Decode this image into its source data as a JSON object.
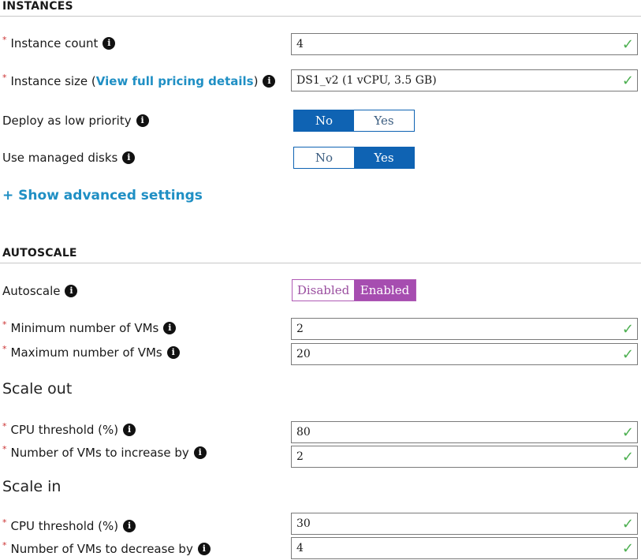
{
  "instances": {
    "heading": "INSTANCES",
    "instance_count": {
      "label": "Instance count",
      "value": "4"
    },
    "instance_size": {
      "label_prefix": "Instance size (",
      "link": "View full pricing details",
      "label_suffix": ")",
      "value": "DS1_v2 (1 vCPU, 3.5 GB)"
    },
    "low_priority": {
      "label": "Deploy as low priority",
      "no": "No",
      "yes": "Yes",
      "selected": "No"
    },
    "managed_disks": {
      "label": "Use managed disks",
      "no": "No",
      "yes": "Yes",
      "selected": "Yes"
    },
    "show_advanced": "+ Show advanced settings"
  },
  "autoscale": {
    "heading": "AUTOSCALE",
    "autoscale_toggle": {
      "label": "Autoscale",
      "disabled": "Disabled",
      "enabled": "Enabled",
      "selected": "Enabled"
    },
    "min_vms": {
      "label": "Minimum number of VMs",
      "value": "2"
    },
    "max_vms": {
      "label": "Maximum number of VMs",
      "value": "20"
    },
    "scale_out": {
      "heading": "Scale out",
      "cpu_threshold": {
        "label": "CPU threshold (%)",
        "value": "80"
      },
      "increase_by": {
        "label": "Number of VMs to increase by",
        "value": "2"
      }
    },
    "scale_in": {
      "heading": "Scale in",
      "cpu_threshold": {
        "label": "CPU threshold (%)",
        "value": "30"
      },
      "decrease_by": {
        "label": "Number of VMs to decrease by",
        "value": "4"
      }
    }
  },
  "icons": {
    "info": "info-icon",
    "required": "asterisk",
    "valid": "checkmark-icon"
  },
  "colors": {
    "toggle_blue": "#0f63b3",
    "toggle_purple": "#a64db0",
    "link": "#1f8fc4",
    "check": "#4caf50"
  }
}
